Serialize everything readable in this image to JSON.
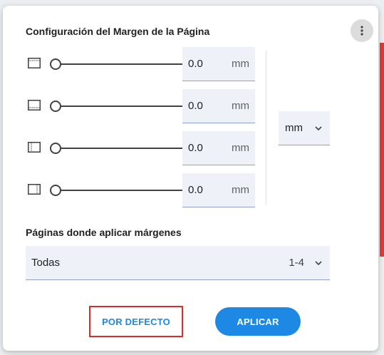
{
  "dialog": {
    "title": "Configuración del Margen de la Página",
    "more_icon": "more-vert-icon"
  },
  "margins": [
    {
      "side": "top",
      "icon": "margin-top-icon",
      "value": "0.0",
      "unit": "mm"
    },
    {
      "side": "bottom",
      "icon": "margin-bottom-icon",
      "value": "0.0",
      "unit": "mm"
    },
    {
      "side": "left",
      "icon": "margin-left-icon",
      "value": "0.0",
      "unit": "mm"
    },
    {
      "side": "right",
      "icon": "margin-right-icon",
      "value": "0.0",
      "unit": "mm"
    }
  ],
  "unit_select": {
    "value": "mm"
  },
  "pages": {
    "title": "Páginas donde aplicar márgenes",
    "value": "Todas",
    "range": "1-4"
  },
  "buttons": {
    "default_label": "POR DEFECTO",
    "apply_label": "APLICAR"
  },
  "colors": {
    "accent": "#1e88e5",
    "highlight_border": "#d32f2f"
  }
}
